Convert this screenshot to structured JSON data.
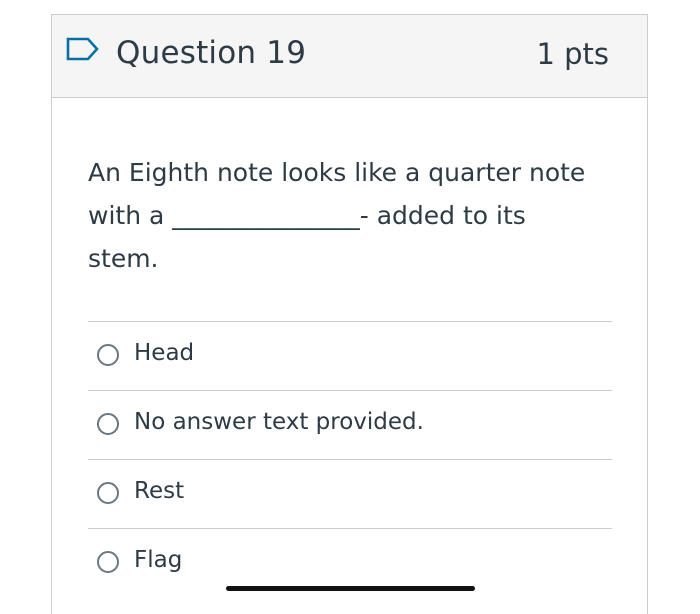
{
  "question": {
    "title": "Question 19",
    "points": "1 pts",
    "text": "An Eighth note looks like a quarter note\nwith a _______________- added to its\nstem.",
    "flag_icon": "flag-outline-icon"
  },
  "answers": [
    {
      "label": "Head",
      "selected": false
    },
    {
      "label": "No answer text provided.",
      "selected": false
    },
    {
      "label": "Rest",
      "selected": false
    },
    {
      "label": "Flag",
      "selected": false
    }
  ],
  "colors": {
    "accent": "#0770a3",
    "header_bg": "#f5f5f5",
    "border": "#c7cdd1",
    "text": "#2d3b45"
  }
}
